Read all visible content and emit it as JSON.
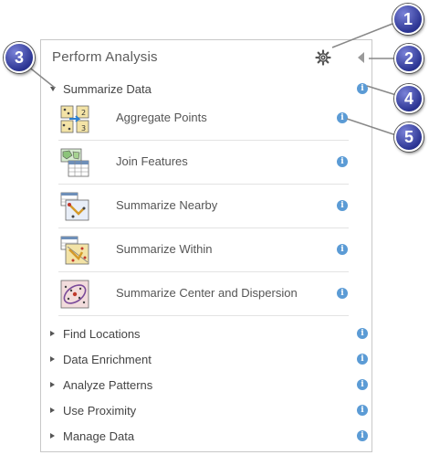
{
  "panel": {
    "title": "Perform Analysis",
    "gear_icon": "gear-icon",
    "collapse_icon": "caret-left-icon"
  },
  "section": {
    "label": "Summarize Data",
    "expanded": true,
    "tools": [
      {
        "label": "Aggregate Points",
        "icon": "aggregate-points-icon"
      },
      {
        "label": "Join Features",
        "icon": "join-features-icon"
      },
      {
        "label": "Summarize Nearby",
        "icon": "summarize-nearby-icon"
      },
      {
        "label": "Summarize Within",
        "icon": "summarize-within-icon"
      },
      {
        "label": "Summarize Center and Dispersion",
        "icon": "summarize-center-dispersion-icon"
      }
    ]
  },
  "categories": [
    {
      "label": "Find Locations"
    },
    {
      "label": "Data Enrichment"
    },
    {
      "label": "Analyze Patterns"
    },
    {
      "label": "Use Proximity"
    },
    {
      "label": "Manage Data"
    }
  ],
  "info_glyph": "i",
  "callouts": [
    "1",
    "2",
    "3",
    "4",
    "5"
  ],
  "colors": {
    "info": "#5b9bd5",
    "callout": "#2c3593",
    "border": "#c8c8c8"
  }
}
